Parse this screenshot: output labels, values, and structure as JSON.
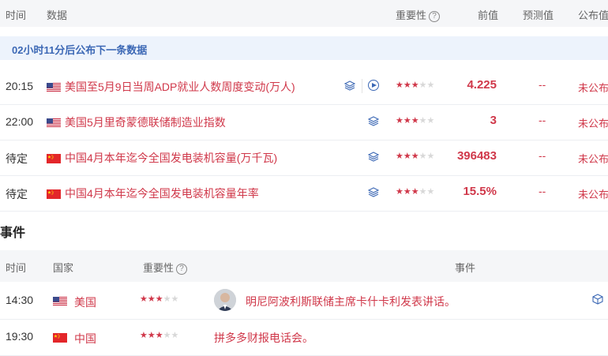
{
  "header": {
    "time": "时间",
    "data": "数据",
    "importance": "重要性",
    "help": "?",
    "previous": "前值",
    "forecast": "预测值",
    "published": "公布值"
  },
  "banner": "02小时11分后公布下一条数据",
  "data_rows": [
    {
      "time": "20:15",
      "country": "US",
      "title": "美国至5月9日当周ADP就业人数周度变动(万人)",
      "stars": 3,
      "previous": "4.225",
      "forecast": "--",
      "status": "未公布"
    },
    {
      "time": "22:00",
      "country": "US",
      "title": "美国5月里奇蒙德联储制造业指数",
      "stars": 3,
      "previous": "3",
      "forecast": "--",
      "status": "未公布"
    },
    {
      "time": "待定",
      "country": "CN",
      "title": "中国4月本年迄今全国发电装机容量(万千瓦)",
      "stars": 3,
      "previous": "396483",
      "forecast": "--",
      "status": "未公布"
    },
    {
      "time": "待定",
      "country": "CN",
      "title": "中国4月本年迄今全国发电装机容量年率",
      "stars": 3,
      "previous": "15.5%",
      "forecast": "--",
      "status": "未公布"
    }
  ],
  "events_section": {
    "title": "事件",
    "header": {
      "time": "时间",
      "country": "国家",
      "importance": "重要性",
      "help": "?",
      "event": "事件"
    },
    "rows": [
      {
        "time": "14:30",
        "country": "美国",
        "stars": 3,
        "event": "明尼阿波利斯联储主席卡什卡利发表讲话。"
      },
      {
        "time": "19:30",
        "country": "中国",
        "stars": 3,
        "event": "拼多多财报电话会。"
      }
    ]
  },
  "colors": {
    "accent_red": "#d0384a",
    "accent_blue": "#3c68b5",
    "header_bg": "#f5f6f8",
    "banner_bg": "#edf3fc"
  },
  "icons": {
    "layers": "layers-icon",
    "play": "play-icon",
    "cube": "cube-icon",
    "star": "star-icon"
  }
}
